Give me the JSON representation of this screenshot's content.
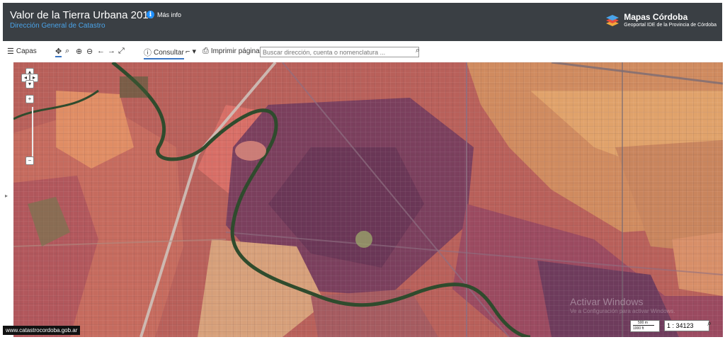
{
  "header": {
    "title": "Valor de la Tierra Urbana 2019",
    "info_label": "Más info",
    "subtitle": "Dirección General de Catastro",
    "logo_title": "Mapas Córdoba",
    "logo_subtitle": "Geoportal IDE de la Provincia de Córdoba"
  },
  "toolbar": {
    "layers_label": "Capas",
    "consult_label": "Consultar",
    "print_label": "Imprimir página",
    "search_placeholder": "Buscar dirección, cuenta o nomenclatura ..."
  },
  "map": {
    "footer_url": "www.catastrocordoba.gob.ar",
    "scale_top": "500 m",
    "scale_bottom": "1000 ft",
    "scale_value": "1 : 34123",
    "watermark_title": "Activar Windows",
    "watermark_sub": "Ve a Configuración para activar Windows.",
    "colors": {
      "header_bg": "#3a3f44",
      "subtitle": "#4aa3e8",
      "accent": "#3a76c4"
    }
  }
}
